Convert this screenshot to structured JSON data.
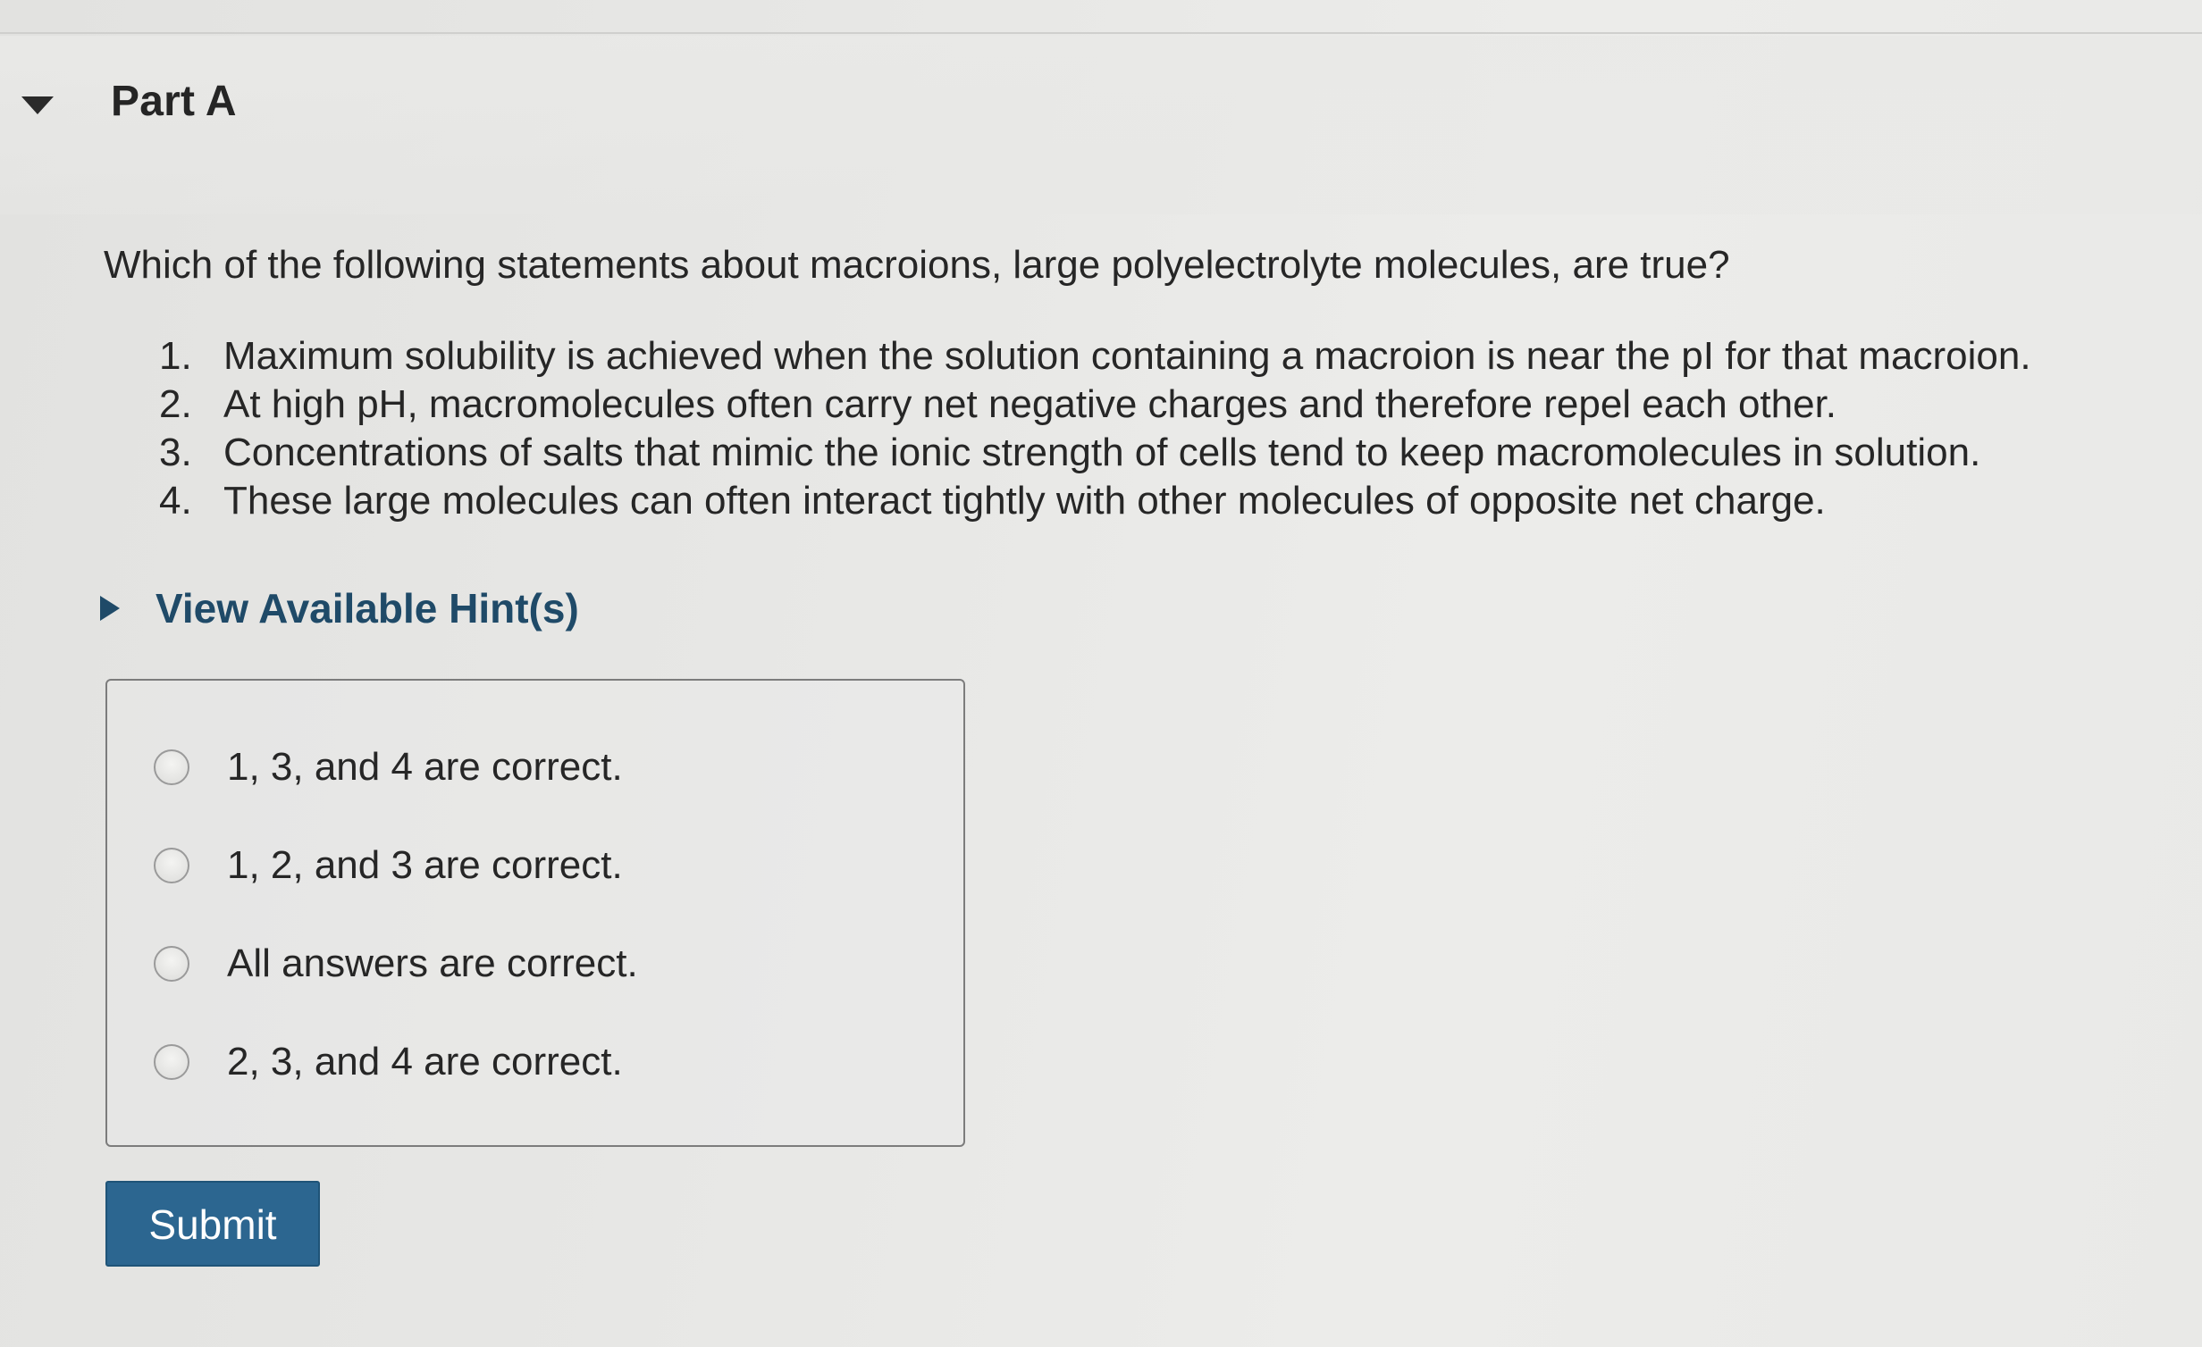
{
  "part": {
    "title": "Part A"
  },
  "question": {
    "prompt": "Which of the following statements about macroions, large polyelectrolyte molecules, are true?",
    "statements": [
      {
        "num": "1.",
        "text": "Maximum solubility is achieved when the solution containing a macroion is near the pI for that macroion."
      },
      {
        "num": "2.",
        "text": "At high pH, macromolecules often carry net negative charges and therefore repel each other."
      },
      {
        "num": "3.",
        "text": "Concentrations of salts that mimic the ionic strength of cells tend to keep macromolecules in solution."
      },
      {
        "num": "4.",
        "text": "These large molecules can often interact tightly with other molecules of opposite net charge."
      }
    ]
  },
  "hints": {
    "label": "View Available Hint(s)"
  },
  "answers": {
    "options": [
      {
        "label": "1, 3, and 4 are correct."
      },
      {
        "label": "1, 2, and 3 are correct."
      },
      {
        "label": "All answers are correct."
      },
      {
        "label": "2, 3, and 4 are correct."
      }
    ]
  },
  "actions": {
    "submit_label": "Submit"
  },
  "colors": {
    "link": "#1f4a68",
    "submit_bg": "#2c6690"
  }
}
